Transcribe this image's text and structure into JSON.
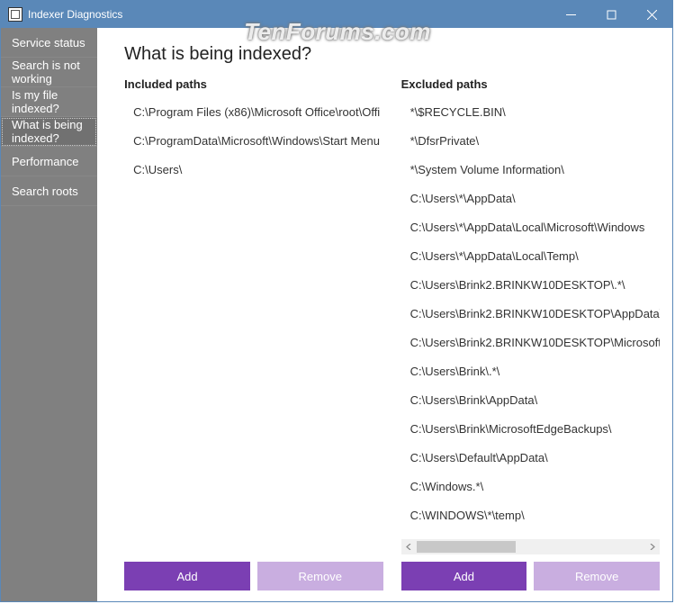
{
  "window": {
    "title": "Indexer Diagnostics"
  },
  "watermark": "TenForums.com",
  "sidebar": {
    "items": [
      {
        "label": "Service status"
      },
      {
        "label": "Search is not working"
      },
      {
        "label": "Is my file indexed?"
      },
      {
        "label": "What is being indexed?"
      },
      {
        "label": "Performance"
      },
      {
        "label": "Search roots"
      }
    ],
    "selected_index": 3
  },
  "main": {
    "title": "What is being indexed?",
    "included": {
      "header": "Included paths",
      "paths": [
        "C:\\Program Files (x86)\\Microsoft Office\\root\\Offi",
        "C:\\ProgramData\\Microsoft\\Windows\\Start Menu",
        "C:\\Users\\"
      ],
      "add_label": "Add",
      "remove_label": "Remove"
    },
    "excluded": {
      "header": "Excluded paths",
      "paths": [
        "*\\$RECYCLE.BIN\\",
        "*\\DfsrPrivate\\",
        "*\\System Volume Information\\",
        "C:\\Users\\*\\AppData\\",
        "C:\\Users\\*\\AppData\\Local\\Microsoft\\Windows",
        "C:\\Users\\*\\AppData\\Local\\Temp\\",
        "C:\\Users\\Brink2.BRINKW10DESKTOP\\.*\\",
        "C:\\Users\\Brink2.BRINKW10DESKTOP\\AppData\\",
        "C:\\Users\\Brink2.BRINKW10DESKTOP\\Microsoft",
        "C:\\Users\\Brink\\.*\\",
        "C:\\Users\\Brink\\AppData\\",
        "C:\\Users\\Brink\\MicrosoftEdgeBackups\\",
        "C:\\Users\\Default\\AppData\\",
        "C:\\Windows.*\\",
        "C:\\WINDOWS\\*\\temp\\"
      ],
      "add_label": "Add",
      "remove_label": "Remove"
    }
  }
}
